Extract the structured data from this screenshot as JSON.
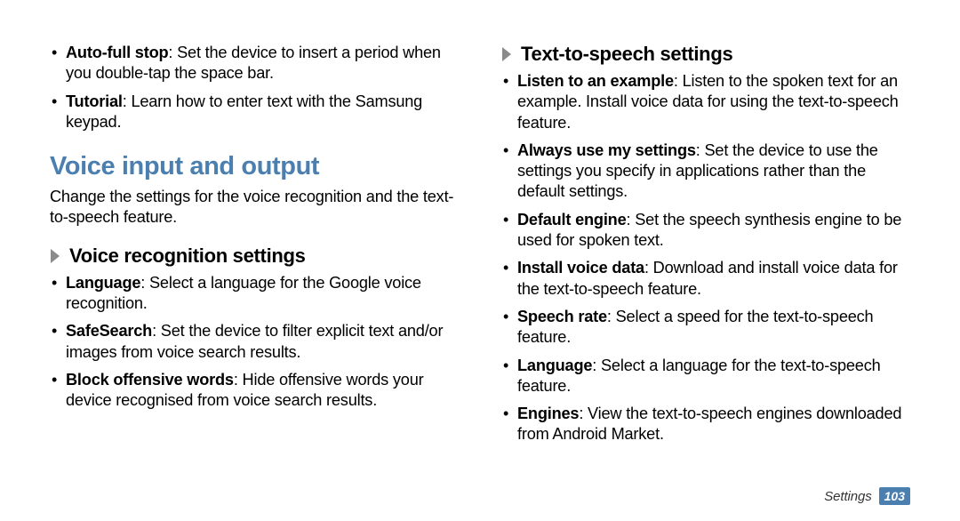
{
  "left": {
    "topBullets": [
      {
        "term": "Auto-full stop",
        "desc": ": Set the device to insert a period when you double-tap the space bar."
      },
      {
        "term": "Tutorial",
        "desc": ": Learn how to enter text with the Samsung keypad."
      }
    ],
    "sectionTitle": "Voice input and output",
    "intro": "Change the settings for the voice recognition and the text-to-speech feature.",
    "subTitle": "Voice recognition settings",
    "voiceRecBullets": [
      {
        "term": "Language",
        "desc": ": Select a language for the Google voice recognition."
      },
      {
        "term": "SafeSearch",
        "desc": ": Set the device to filter explicit text and/or images from voice search results."
      },
      {
        "term": "Block offensive words",
        "desc": ": Hide offensive words your device recognised from voice search results."
      }
    ]
  },
  "right": {
    "subTitle": "Text-to-speech settings",
    "ttsBullets": [
      {
        "term": "Listen to an example",
        "desc": ": Listen to the spoken text for an example. Install voice data for using the text-to-speech feature."
      },
      {
        "term": "Always use my settings",
        "desc": ": Set the device to use the settings you specify in applications rather than the default settings."
      },
      {
        "term": "Default engine",
        "desc": ": Set the speech synthesis engine to be used for spoken text."
      },
      {
        "term": "Install voice data",
        "desc": ": Download and install voice data for the text-to-speech feature."
      },
      {
        "term": "Speech rate",
        "desc": ": Select a speed for the text-to-speech feature."
      },
      {
        "term": "Language",
        "desc": ": Select a language for the text-to-speech feature."
      },
      {
        "term": "Engines",
        "desc": ": View the text-to-speech engines downloaded from Android Market."
      }
    ]
  },
  "footer": {
    "label": "Settings",
    "page": "103"
  }
}
